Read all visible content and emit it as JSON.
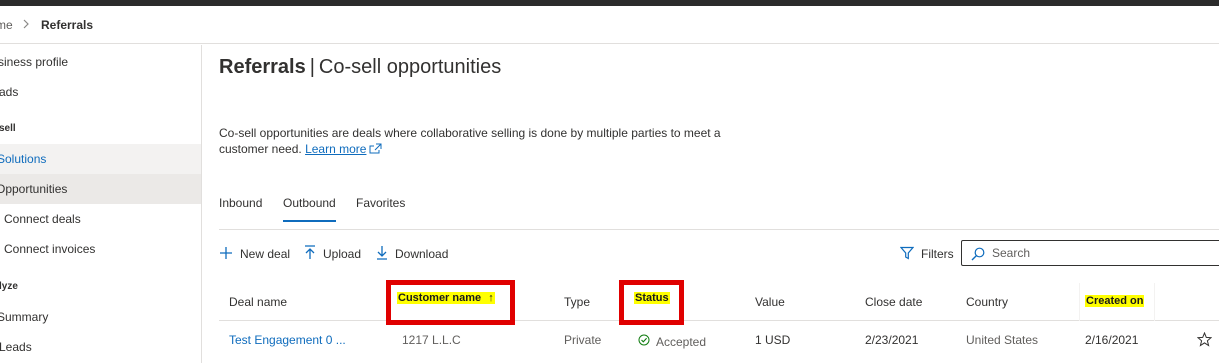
{
  "breadcrumb": {
    "home": "me",
    "separator": ">",
    "current": "Referrals"
  },
  "sidebar": {
    "items": [
      {
        "label": "siness profile"
      },
      {
        "label": "ads"
      },
      {
        "heading": "sell"
      },
      {
        "label": "Solutions"
      },
      {
        "label": "Opportunities"
      },
      {
        "label": "Connect deals"
      },
      {
        "label": "Connect invoices"
      },
      {
        "heading": "lyze"
      },
      {
        "label": "Summary"
      },
      {
        "label": "Leads"
      }
    ]
  },
  "header": {
    "title_bold": "Referrals",
    "title_sep": "|",
    "title_rest": "Co-sell opportunities"
  },
  "description": {
    "text": "Co-sell opportunities are deals where collaborative selling is done by multiple parties to meet a customer need.",
    "learn_more": "Learn more"
  },
  "tabs": [
    {
      "label": "Inbound",
      "active": false
    },
    {
      "label": "Outbound",
      "active": true
    },
    {
      "label": "Favorites",
      "active": false
    }
  ],
  "toolbar": {
    "new_deal": "New deal",
    "upload": "Upload",
    "download": "Download",
    "filters": "Filters",
    "search_placeholder": "Search"
  },
  "table": {
    "columns": {
      "deal_name": "Deal name",
      "customer_name": "Customer name",
      "sort_indicator": "↑",
      "type": "Type",
      "status": "Status",
      "value": "Value",
      "close_date": "Close date",
      "country": "Country",
      "created_on": "Created on"
    },
    "rows": [
      {
        "deal_name": "Test Engagement 0 ...",
        "customer_name": "1217 L.L.C",
        "type": "Private",
        "status": "Accepted",
        "value": "1 USD",
        "close_date": "2/23/2021",
        "country": "United States",
        "created_on": "2/16/2021"
      }
    ]
  },
  "colors": {
    "accent": "#0f6cbd",
    "highlight_border": "#e00000",
    "highlight_fill": "#ffff00",
    "status_ok": "#107c10"
  },
  "icons": {
    "add": "plus-icon",
    "upload": "upload-arrow-icon",
    "download": "download-arrow-icon",
    "filter": "funnel-icon",
    "search": "search-icon",
    "status": "check-circle-icon",
    "favorite": "star-icon",
    "external": "external-link-icon"
  }
}
